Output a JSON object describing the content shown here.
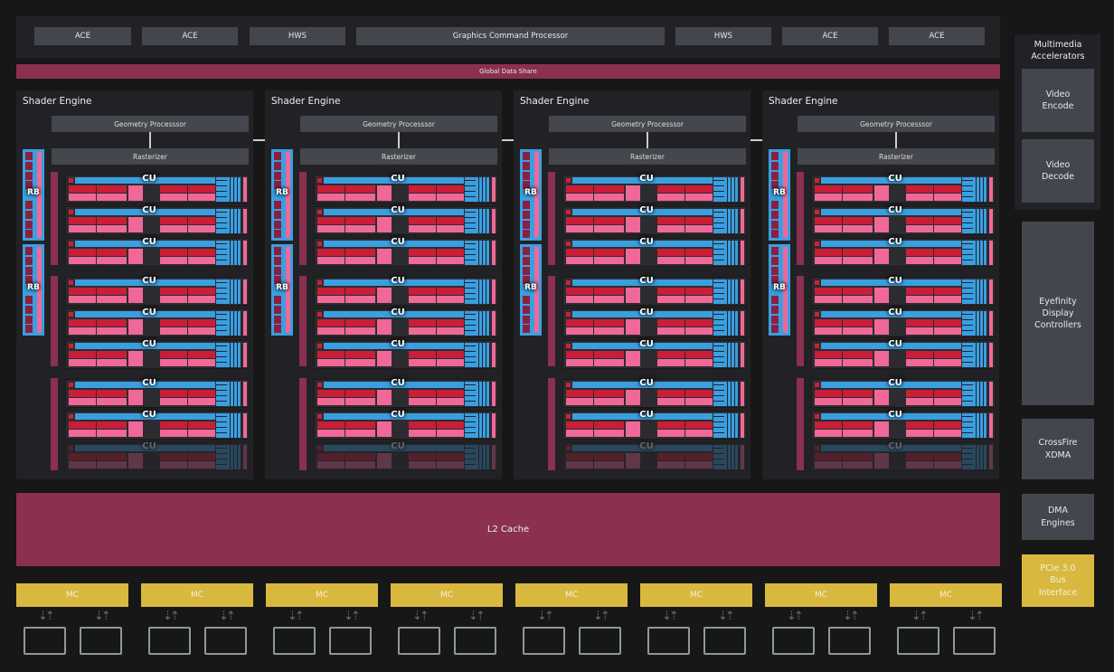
{
  "top_bar": {
    "blocks": [
      "ACE",
      "ACE",
      "HWS",
      "Graphics Command Processor",
      "HWS",
      "ACE",
      "ACE"
    ]
  },
  "global_data_share": "Global Data Share",
  "shader_engines": [
    {
      "title": "Shader Engine",
      "geometry": "Geometry Processsor",
      "rasterizer": "Rasterizer",
      "rb_label": "RB",
      "cu_label": "CU"
    },
    {
      "title": "Shader Engine",
      "geometry": "Geometry Processsor",
      "rasterizer": "Rasterizer",
      "rb_label": "RB",
      "cu_label": "CU"
    },
    {
      "title": "Shader Engine",
      "geometry": "Geometry Processsor",
      "rasterizer": "Rasterizer",
      "rb_label": "RB",
      "cu_label": "CU"
    },
    {
      "title": "Shader Engine",
      "geometry": "Geometry Processsor",
      "rasterizer": "Rasterizer",
      "rb_label": "RB",
      "cu_label": "CU"
    }
  ],
  "l2_cache": "L2 Cache",
  "memory_controllers": [
    "MC",
    "MC",
    "MC",
    "MC",
    "MC",
    "MC",
    "MC",
    "MC"
  ],
  "side": {
    "multimedia_title": "Multimedia Accelerators",
    "video_encode": "Video Encode",
    "video_decode": "Video Decode",
    "eyefinity": "Eyefinity Display Controllers",
    "crossfire": "CrossFire XDMA",
    "dma": "DMA Engines",
    "pcie": "PCIe 3.0 Bus Interface"
  },
  "colors": {
    "background": "#171717",
    "panel": "#222226",
    "block": "#44464d",
    "fabric": "#8b3050",
    "mc": "#d9b840",
    "cu_blue": "#3a9fe0",
    "cu_red": "#c81e38",
    "cu_pink": "#f06898"
  }
}
